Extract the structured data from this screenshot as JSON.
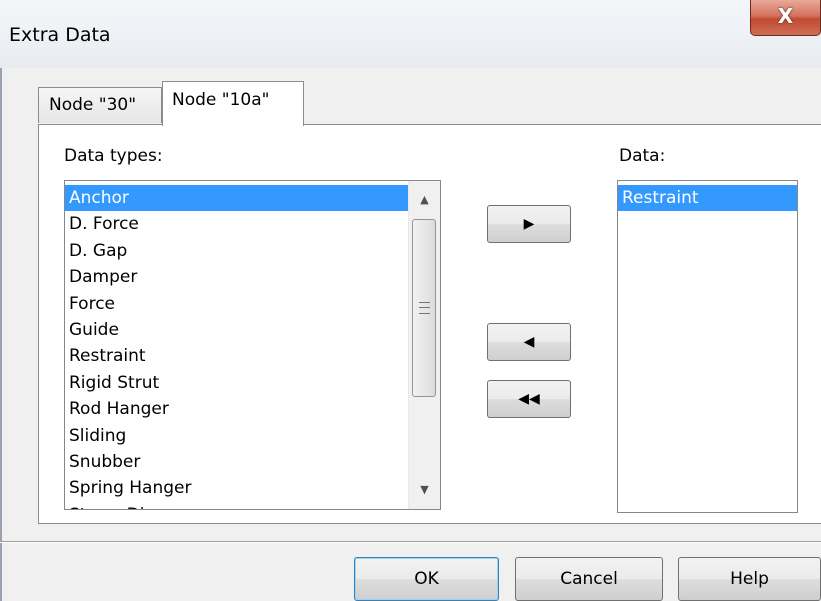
{
  "window": {
    "title": "Extra Data",
    "close_label": "X"
  },
  "tabs": [
    {
      "label": "Node \"30\"",
      "active": false
    },
    {
      "label": "Node \"10a\"",
      "active": true
    }
  ],
  "data_types": {
    "label": "Data types:",
    "items": [
      {
        "label": "Anchor",
        "selected": true
      },
      {
        "label": "D. Force",
        "selected": false
      },
      {
        "label": "D. Gap",
        "selected": false
      },
      {
        "label": "Damper",
        "selected": false
      },
      {
        "label": "Force",
        "selected": false
      },
      {
        "label": "Guide",
        "selected": false
      },
      {
        "label": "Restraint",
        "selected": false
      },
      {
        "label": "Rigid Strut",
        "selected": false
      },
      {
        "label": "Rod Hanger",
        "selected": false
      },
      {
        "label": "Sliding",
        "selected": false
      },
      {
        "label": "Snubber",
        "selected": false
      },
      {
        "label": "Spring Hanger",
        "selected": false
      },
      {
        "label": "Stress Disc.",
        "selected": false
      }
    ]
  },
  "data": {
    "label": "Data:",
    "items": [
      {
        "label": "Restraint",
        "selected": true
      }
    ]
  },
  "transfer_buttons": {
    "add_icon": "right-arrow-icon",
    "remove_icon": "left-arrow-icon",
    "remove_all_icon": "double-left-arrow-icon",
    "add_glyph": "▶",
    "remove_glyph": "◀",
    "remove_all_glyph": "◀◀"
  },
  "footer": {
    "ok_label": "OK",
    "cancel_label": "Cancel",
    "help_label": "Help"
  },
  "colors": {
    "selection": "#3399ff",
    "close_button": "#c24a32"
  }
}
